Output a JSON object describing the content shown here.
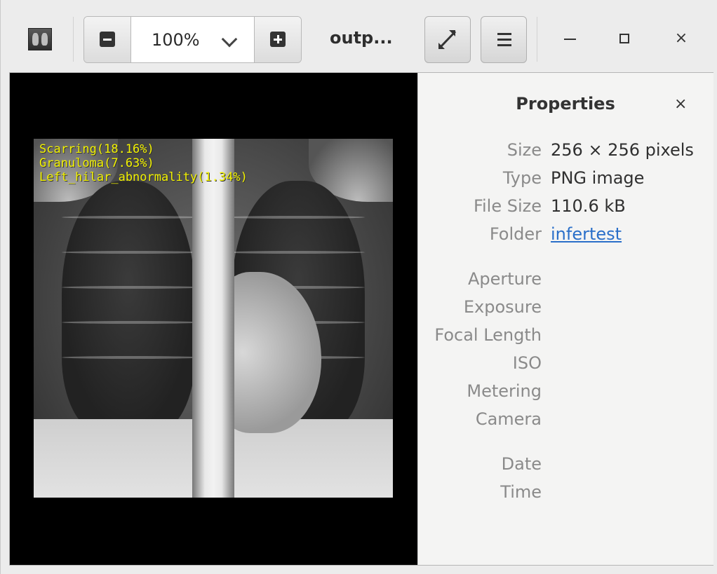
{
  "toolbar": {
    "zoom_value": "100%",
    "title": "outp...",
    "app_icon": "xray-thumbnail-icon",
    "zoom_out_icon": "minus-icon",
    "zoom_in_icon": "plus-icon",
    "fullscreen_icon": "fullscreen-icon",
    "menu_icon": "hamburger-menu-icon"
  },
  "window_controls": {
    "close": "×"
  },
  "image": {
    "annotations": [
      "Scarring(18.16%)",
      "Granuloma(7.63%)",
      "Left_hilar_abnormality(1.34%)"
    ]
  },
  "properties": {
    "title": "Properties",
    "close": "×",
    "rows": [
      {
        "label": "Size",
        "value": "256 × 256 pixels"
      },
      {
        "label": "Type",
        "value": "PNG image"
      },
      {
        "label": "File Size",
        "value": "110.6 kB"
      },
      {
        "label": "Folder",
        "value": "infertest"
      },
      {
        "label": "Aperture",
        "value": ""
      },
      {
        "label": "Exposure",
        "value": ""
      },
      {
        "label": "Focal Length",
        "value": ""
      },
      {
        "label": "ISO",
        "value": ""
      },
      {
        "label": "Metering",
        "value": ""
      },
      {
        "label": "Camera",
        "value": ""
      },
      {
        "label": "Date",
        "value": ""
      },
      {
        "label": "Time",
        "value": ""
      }
    ]
  },
  "colors": {
    "annotation_text": "#f2f200",
    "link": "#2a6fc9"
  }
}
